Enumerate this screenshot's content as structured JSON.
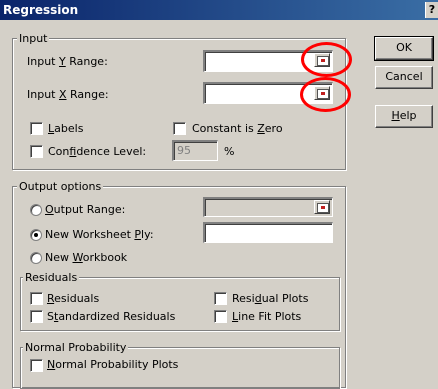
{
  "dialog": {
    "title": "Regression",
    "help_button": "?"
  },
  "buttons": {
    "ok": "OK",
    "cancel": "Cancel",
    "help_pre": "",
    "help_u": "H",
    "help_post": "elp"
  },
  "input": {
    "legend": "Input",
    "y_range": {
      "pre": "Input ",
      "u": "Y",
      "post": " Range:",
      "value": ""
    },
    "x_range": {
      "pre": "Input ",
      "u": "X",
      "post": " Range:",
      "value": ""
    },
    "labels": {
      "pre": "",
      "u": "L",
      "post": "abels",
      "checked": false
    },
    "constant_zero": {
      "pre": "Constant is ",
      "u": "Z",
      "post": "ero",
      "checked": false
    },
    "confidence": {
      "pre": "Con",
      "u": "f",
      "post": "idence Level:",
      "checked": false,
      "value": "95",
      "unit": "%"
    }
  },
  "output": {
    "legend": "Output options",
    "output_range": {
      "pre": "",
      "u": "O",
      "post": "utput Range:",
      "selected": false
    },
    "new_worksheet": {
      "pre": "New Worksheet ",
      "u": "P",
      "post": "ly:",
      "selected": true
    },
    "new_workbook": {
      "pre": "New ",
      "u": "W",
      "post": "orkbook",
      "selected": false
    }
  },
  "residuals": {
    "legend": "Residuals",
    "residuals": {
      "pre": "",
      "u": "R",
      "post": "esiduals"
    },
    "standardized": {
      "pre": "S",
      "u": "t",
      "post": "andardized Residuals"
    },
    "residual_plots": {
      "pre": "Resi",
      "u": "d",
      "post": "ual Plots"
    },
    "line_fit": {
      "pre": "",
      "u": "L",
      "post": "ine Fit Plots"
    }
  },
  "normal": {
    "legend": "Normal Probability",
    "plots": {
      "pre": "",
      "u": "N",
      "post": "ormal Probability Plots"
    }
  },
  "colors": {
    "annotation": "#ff0000",
    "titlebar": "#0a246a"
  },
  "icons": {
    "range_selector": "range-selector-icon"
  }
}
